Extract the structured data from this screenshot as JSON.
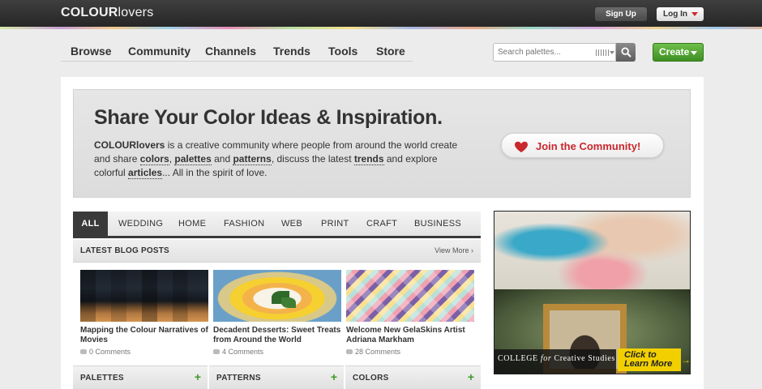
{
  "header": {
    "logo_bold": "COLOUR",
    "logo_rest": "lovers",
    "signup_label": "Sign Up",
    "login_label": "Log In"
  },
  "nav": {
    "items": [
      "Browse",
      "Community",
      "Channels",
      "Trends",
      "Tools",
      "Store"
    ],
    "search_placeholder": "Search palettes...",
    "create_label": "Create"
  },
  "hero": {
    "title": "Share Your Color Ideas & Inspiration.",
    "desc_brand": "COLOURlovers",
    "desc_1": " is a creative community where people from around the world create and share ",
    "link_colors": "colors",
    "desc_2": ", ",
    "link_palettes": "palettes",
    "desc_3": " and ",
    "link_patterns": "patterns",
    "desc_4": ", discuss the latest ",
    "link_trends": "trends",
    "desc_5": " and explore colorful ",
    "link_articles": "articles",
    "desc_6": "... All in the spirit of love.",
    "join_label": "Join the Community!"
  },
  "tabs": [
    "ALL",
    "WEDDING",
    "HOME",
    "FASHION",
    "WEB",
    "PRINT",
    "CRAFT",
    "BUSINESS"
  ],
  "blog": {
    "heading": "LATEST BLOG POSTS",
    "view_more": "View More ›",
    "posts": [
      {
        "title": "Mapping the Colour Narratives of Movies",
        "comments": "0 Comments"
      },
      {
        "title": "Decadent Desserts: Sweet Treats from Around the World",
        "comments": "4 Comments"
      },
      {
        "title": "Welcome New GelaSkins Artist Adriana Markham",
        "comments": "28 Comments"
      }
    ]
  },
  "sections": [
    "PALETTES",
    "PATTERNS",
    "COLORS"
  ],
  "ad": {
    "college_1": "COLLEGE",
    "college_for": "for",
    "college_2": "Creative Studies",
    "click_1": "Click to",
    "click_2": "Learn More"
  },
  "colors": {
    "accent_green": "#3f8f23",
    "heart_red": "#c8282e",
    "topbar": "#2f2f2f"
  }
}
